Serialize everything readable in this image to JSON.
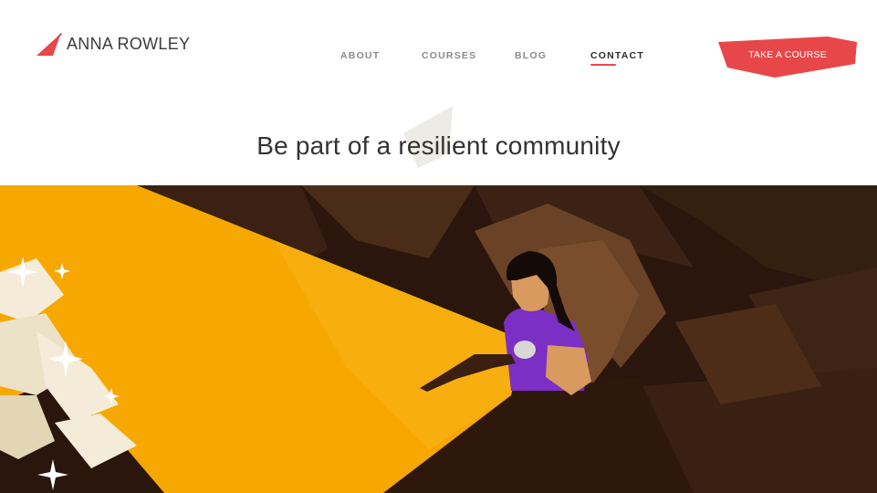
{
  "brand": {
    "name": "ANNA ROWLEY",
    "logo_icon": "triangle-logo-icon",
    "accent_color": "#e8474a"
  },
  "nav": {
    "items": [
      {
        "label": "ABOUT",
        "active": false
      },
      {
        "label": "COURSES",
        "active": false
      },
      {
        "label": "BLOG",
        "active": false
      },
      {
        "label": "CONTACT",
        "active": true
      }
    ]
  },
  "cta": {
    "label": "TAKE A COURSE",
    "color": "#e8474a"
  },
  "hero": {
    "title": "Be part of a resilient community"
  },
  "illustration": {
    "subject": "person-with-flashlight-in-cave",
    "colors": {
      "beam": "#f6a800",
      "cave": "#2a160c",
      "rock": "#6a4226",
      "shirt": "#7b2fc4",
      "skin": "#d89a5e",
      "crystals": "#f4ecd8"
    }
  }
}
